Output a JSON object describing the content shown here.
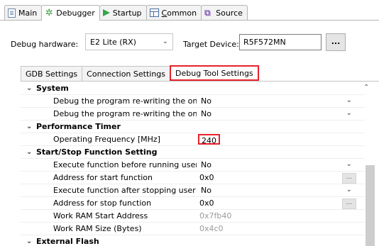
{
  "tabs": [
    {
      "label": "Main",
      "icon": "main-config-icon",
      "active": false
    },
    {
      "label": "Debugger",
      "icon": "debugger-icon",
      "active": true
    },
    {
      "label": "Startup",
      "icon": "startup-icon",
      "active": false
    },
    {
      "label": "Common",
      "icon": "common-icon",
      "active": false,
      "accel": "C"
    },
    {
      "label": "Source",
      "icon": "source-icon",
      "active": false
    }
  ],
  "hardware": {
    "label": "Debug hardware:",
    "value": "E2 Lite (RX)"
  },
  "target": {
    "label": "Target Device:",
    "value": "R5F572MN",
    "browse": "..."
  },
  "subtabs": [
    {
      "label": "GDB Settings",
      "active": false
    },
    {
      "label": "Connection Settings",
      "active": false
    },
    {
      "label": "Debug Tool Settings",
      "active": true
    }
  ],
  "tree": {
    "system": {
      "label": "System",
      "rows": [
        {
          "name": "Debug the program re-writing the on-c",
          "value": "No"
        },
        {
          "name": "Debug the program re-writing the on-c",
          "value": "No"
        }
      ]
    },
    "perf": {
      "label": "Performance Timer",
      "rows": [
        {
          "name": "Operating Frequency [MHz]",
          "value": "240"
        }
      ]
    },
    "startstop": {
      "label": "Start/Stop Function Setting",
      "rows": [
        {
          "name": "Execute function before running user p",
          "value": "No"
        },
        {
          "name": "Address for start function",
          "value": "0x0"
        },
        {
          "name": "Execute function after stopping user pr",
          "value": "No"
        },
        {
          "name": "Address for stop function",
          "value": "0x0"
        },
        {
          "name": "Work RAM Start Address",
          "value": "0x7fb40"
        },
        {
          "name": "Work RAM Size (Bytes)",
          "value": "0x4c0"
        }
      ]
    },
    "extflash": {
      "label": "External Flash"
    }
  },
  "colors": {
    "highlight": "#e8202a",
    "scrollbar": "#cdcdcd"
  }
}
